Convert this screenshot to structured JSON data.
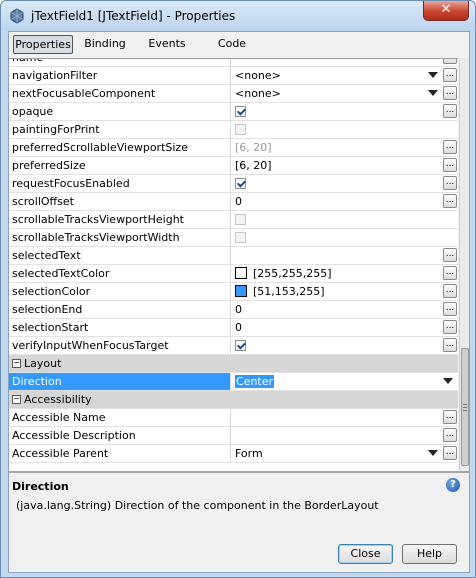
{
  "window": {
    "title": "jTextField1 [JTextField] - Properties",
    "close_label": "✕"
  },
  "tabs": [
    "Properties",
    "Binding",
    "Events",
    "Code"
  ],
  "properties": [
    {
      "name": "name",
      "value": ""
    },
    {
      "name": "navigationFilter",
      "value": "<none>",
      "kind": "combo"
    },
    {
      "name": "nextFocusableComponent",
      "value": "<none>",
      "kind": "combo"
    },
    {
      "name": "opaque",
      "value": "",
      "kind": "checkbox",
      "checked": true
    },
    {
      "name": "paintingForPrint",
      "value": "",
      "kind": "checkbox",
      "checked": false,
      "disabled": true,
      "noEllipsis": true
    },
    {
      "name": "preferredScrollableViewportSize",
      "value": "[6, 20]",
      "muted": true
    },
    {
      "name": "preferredSize",
      "value": "[6, 20]"
    },
    {
      "name": "requestFocusEnabled",
      "value": "",
      "kind": "checkbox",
      "checked": true
    },
    {
      "name": "scrollOffset",
      "value": "0"
    },
    {
      "name": "scrollableTracksViewportHeight",
      "value": "",
      "kind": "checkbox",
      "checked": false,
      "disabled": true,
      "noEllipsis": true
    },
    {
      "name": "scrollableTracksViewportWidth",
      "value": "",
      "kind": "checkbox",
      "checked": false,
      "disabled": true,
      "noEllipsis": true
    },
    {
      "name": "selectedText",
      "value": ""
    },
    {
      "name": "selectedTextColor",
      "value": "[255,255,255]",
      "kind": "color",
      "color": "#ffffff"
    },
    {
      "name": "selectionColor",
      "value": "[51,153,255]",
      "kind": "color",
      "color": "#3399ff"
    },
    {
      "name": "selectionEnd",
      "value": "0"
    },
    {
      "name": "selectionStart",
      "value": "0"
    },
    {
      "name": "verifyInputWhenFocusTarget",
      "value": "",
      "kind": "checkbox",
      "checked": true
    },
    {
      "name": "Layout",
      "kind": "category"
    },
    {
      "name": "Direction",
      "value": "Center",
      "kind": "selected-combo"
    },
    {
      "name": "Accessibility",
      "kind": "category"
    },
    {
      "name": "Accessible Name",
      "value": ""
    },
    {
      "name": "Accessible Description",
      "value": ""
    },
    {
      "name": "Accessible Parent",
      "value": "Form",
      "kind": "combo"
    }
  ],
  "ellipsis_label": "...",
  "category_toggle": "−",
  "help": {
    "title": "Direction",
    "description": "(java.lang.String) Direction of the component in the BorderLayout",
    "icon_label": "?"
  },
  "buttons": {
    "close": "Close",
    "help": "Help"
  },
  "colors": {
    "selection": "#3399ff",
    "title_bar": "#c2d9ef",
    "category_bg": "#d6d6d6"
  }
}
